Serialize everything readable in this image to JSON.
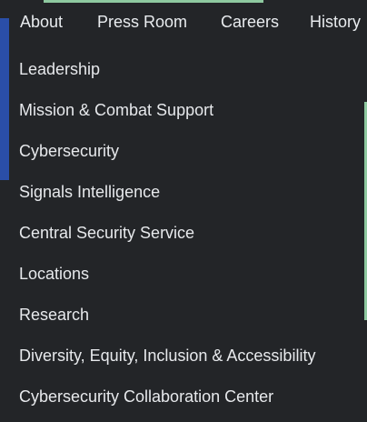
{
  "top_nav": {
    "items": [
      {
        "label": "About"
      },
      {
        "label": "Press Room"
      },
      {
        "label": "Careers"
      },
      {
        "label": "History"
      }
    ]
  },
  "menu": {
    "items": [
      {
        "label": "Leadership"
      },
      {
        "label": "Mission & Combat Support"
      },
      {
        "label": "Cybersecurity"
      },
      {
        "label": "Signals Intelligence"
      },
      {
        "label": "Central Security Service"
      },
      {
        "label": "Locations"
      },
      {
        "label": "Research"
      },
      {
        "label": "Diversity, Equity, Inclusion & Accessibility"
      },
      {
        "label": "Cybersecurity Collaboration Center"
      }
    ]
  },
  "colors": {
    "background": "#232528",
    "text": "#e7e9ec",
    "left_accent": "#2a4ea8",
    "green_accent": "#8ec9a0"
  }
}
